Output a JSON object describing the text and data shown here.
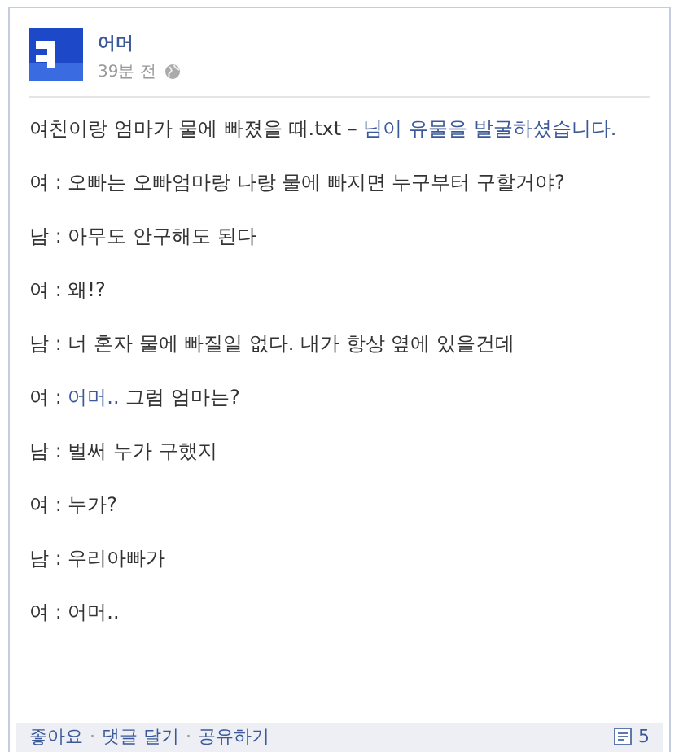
{
  "post": {
    "author": "어머",
    "time": "39분 전",
    "title": [
      {
        "kind": "plain",
        "text": "여친이랑 엄마가 물에 빠졌을 때.txt – "
      },
      {
        "kind": "link",
        "text": "님이 유물을 발굴하셨습니다."
      }
    ],
    "lines": [
      [
        {
          "kind": "plain",
          "text": "여 : 오빠는 오빠엄마랑 나랑 물에 빠지면 누구부터 구할거야?"
        }
      ],
      [
        {
          "kind": "plain",
          "text": "남 : 아무도 안구해도 된다"
        }
      ],
      [
        {
          "kind": "plain",
          "text": "여 : 왜!?"
        }
      ],
      [
        {
          "kind": "plain",
          "text": "남 : 너 혼자 물에 빠질일 없다. 내가 항상 옆에 있을건데"
        }
      ],
      [
        {
          "kind": "plain",
          "text": "여 : "
        },
        {
          "kind": "link",
          "text": "어머.."
        },
        {
          "kind": "plain",
          "text": " 그럼 엄마는?"
        }
      ],
      [
        {
          "kind": "plain",
          "text": "남 : 벌써 누가 구했지"
        }
      ],
      [
        {
          "kind": "plain",
          "text": "여 : 누가?"
        }
      ],
      [
        {
          "kind": "plain",
          "text": "남 : 우리아빠가"
        }
      ],
      [
        {
          "kind": "plain",
          "text": "여 : 어머.."
        }
      ]
    ]
  },
  "footer": {
    "actions": [
      "좋아요",
      "댓글 달기",
      "공유하기"
    ],
    "separator": "·",
    "comment_count": "5"
  }
}
